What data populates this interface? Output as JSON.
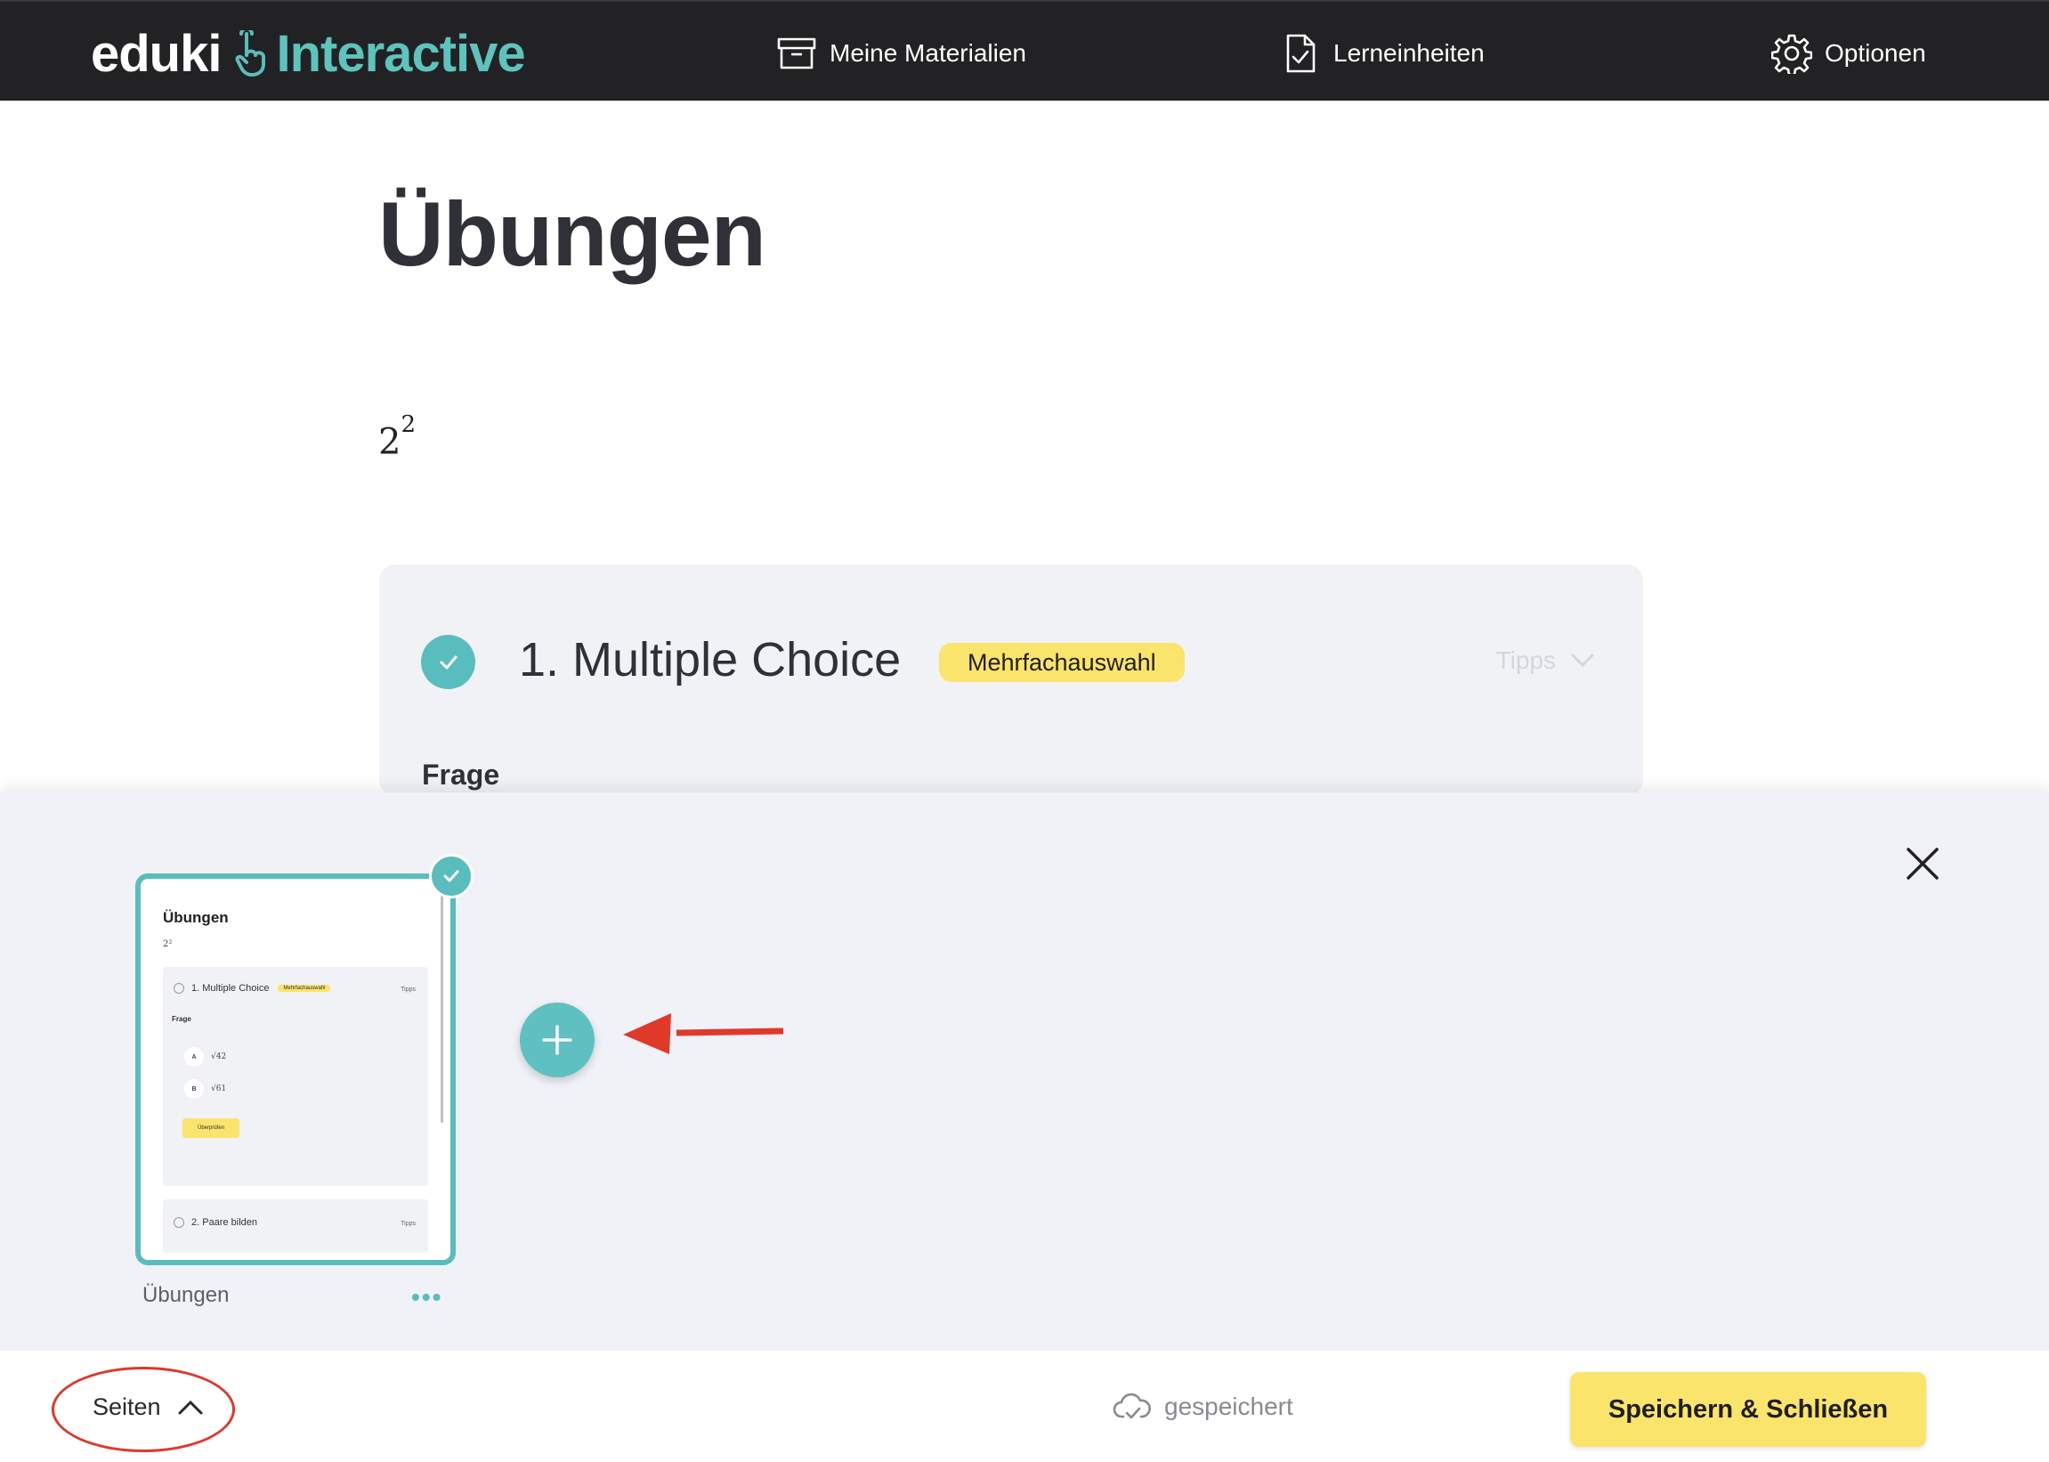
{
  "nav": {
    "logo_part1": "eduki",
    "logo_part2": "Interactive",
    "materials": "Meine Materialien",
    "units": "Lerneinheiten",
    "options": "Optionen"
  },
  "page": {
    "title": "Übungen",
    "formula_base": "2",
    "formula_exp": "2"
  },
  "exercise": {
    "title": "1. Multiple Choice",
    "badge": "Mehrfachauswahl",
    "tips": "Tipps",
    "question_label": "Frage"
  },
  "pages_panel": {
    "thumbnail": {
      "title": "Übungen",
      "formula": "2²",
      "ex1_title": "1. Multiple Choice",
      "ex1_badge": "Mehrfachauswahl",
      "tips": "Tipps",
      "question": "Frage",
      "opt_a_label": "A",
      "opt_a_value": "√42",
      "opt_b_label": "B",
      "opt_b_value": "√61",
      "check_button": "Überprüfen",
      "ex2_title": "2. Paare bilden"
    },
    "page_name": "Übungen",
    "more": "•••"
  },
  "footer": {
    "pages_toggle": "Seiten",
    "status": "gespeichert",
    "save_close": "Speichern & Schließen"
  },
  "colors": {
    "accent": "#59bcbd",
    "badge_yellow": "#fbe46c",
    "nav_bg": "#222224",
    "annotation_red": "#e0392a"
  }
}
